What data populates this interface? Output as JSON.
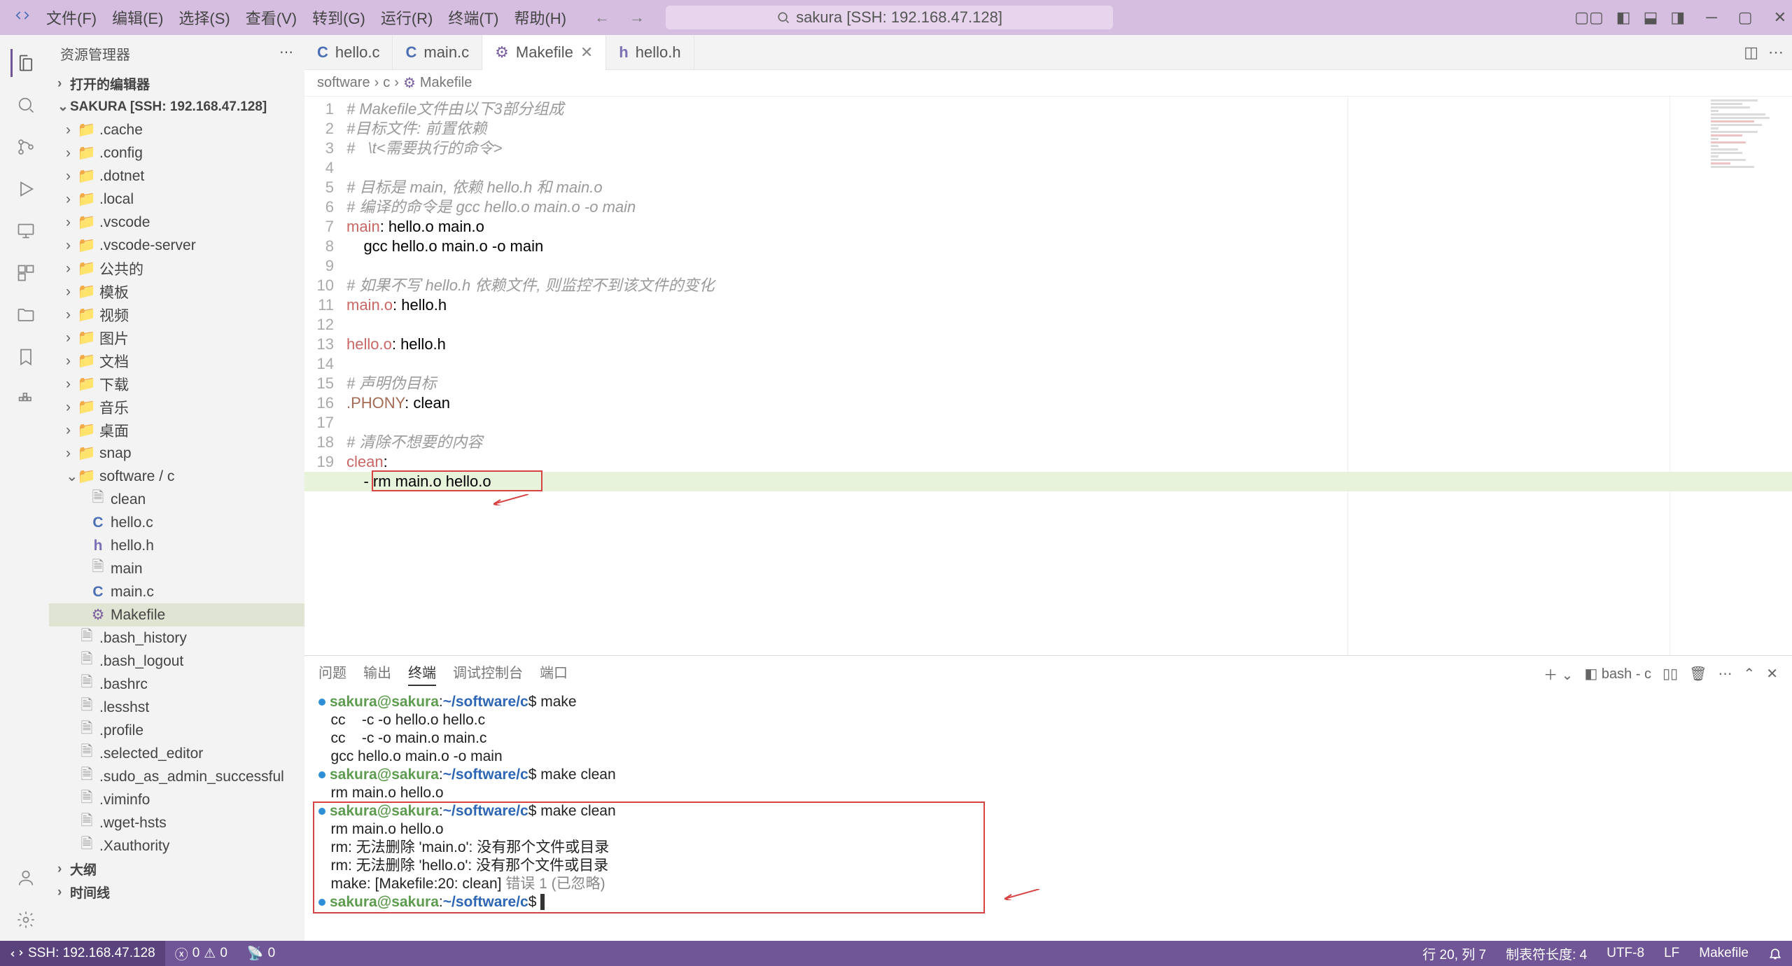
{
  "menubar": [
    "文件(F)",
    "编辑(E)",
    "选择(S)",
    "查看(V)",
    "转到(G)",
    "运行(R)",
    "终端(T)",
    "帮助(H)"
  ],
  "search_placeholder": "sakura [SSH: 192.168.47.128]",
  "sidebar_title": "资源管理器",
  "sections": {
    "open_editors": "打开的编辑器",
    "workspace": "SAKURA [SSH: 192.168.47.128]",
    "outline": "大纲",
    "timeline": "时间线"
  },
  "tree": [
    {
      "d": 1,
      "kind": "folder",
      "label": ".cache"
    },
    {
      "d": 1,
      "kind": "folder",
      "label": ".config"
    },
    {
      "d": 1,
      "kind": "folder",
      "label": ".dotnet"
    },
    {
      "d": 1,
      "kind": "folder",
      "label": ".local"
    },
    {
      "d": 1,
      "kind": "folder",
      "label": ".vscode"
    },
    {
      "d": 1,
      "kind": "folder",
      "label": ".vscode-server"
    },
    {
      "d": 1,
      "kind": "folder",
      "label": "公共的"
    },
    {
      "d": 1,
      "kind": "folder",
      "label": "模板"
    },
    {
      "d": 1,
      "kind": "folder",
      "label": "视频"
    },
    {
      "d": 1,
      "kind": "folder",
      "label": "图片"
    },
    {
      "d": 1,
      "kind": "folder",
      "label": "文档"
    },
    {
      "d": 1,
      "kind": "folder",
      "label": "下载"
    },
    {
      "d": 1,
      "kind": "folder",
      "label": "音乐"
    },
    {
      "d": 1,
      "kind": "folder",
      "label": "桌面"
    },
    {
      "d": 1,
      "kind": "folder",
      "label": "snap"
    },
    {
      "d": 1,
      "kind": "folder-open",
      "label": "software / c"
    },
    {
      "d": 2,
      "kind": "file",
      "label": "clean"
    },
    {
      "d": 2,
      "kind": "c",
      "label": "hello.c"
    },
    {
      "d": 2,
      "kind": "h",
      "label": "hello.h"
    },
    {
      "d": 2,
      "kind": "file",
      "label": "main"
    },
    {
      "d": 2,
      "kind": "c",
      "label": "main.c"
    },
    {
      "d": 2,
      "kind": "make",
      "label": "Makefile",
      "selected": true
    },
    {
      "d": 1,
      "kind": "file",
      "label": ".bash_history"
    },
    {
      "d": 1,
      "kind": "file",
      "label": ".bash_logout"
    },
    {
      "d": 1,
      "kind": "file",
      "label": ".bashrc"
    },
    {
      "d": 1,
      "kind": "file",
      "label": ".lesshst"
    },
    {
      "d": 1,
      "kind": "file",
      "label": ".profile"
    },
    {
      "d": 1,
      "kind": "file",
      "label": ".selected_editor"
    },
    {
      "d": 1,
      "kind": "file",
      "label": ".sudo_as_admin_successful"
    },
    {
      "d": 1,
      "kind": "file",
      "label": ".viminfo"
    },
    {
      "d": 1,
      "kind": "file",
      "label": ".wget-hsts"
    },
    {
      "d": 1,
      "kind": "file",
      "label": ".Xauthority"
    }
  ],
  "tabs": [
    {
      "icon": "c",
      "label": "hello.c",
      "active": false
    },
    {
      "icon": "c",
      "label": "main.c",
      "active": false
    },
    {
      "icon": "make",
      "label": "Makefile",
      "active": true,
      "close": true
    },
    {
      "icon": "h",
      "label": "hello.h",
      "active": false
    }
  ],
  "breadcrumb": [
    "software",
    "c",
    "Makefile"
  ],
  "code_lines": [
    {
      "n": 1,
      "c": "comment",
      "t": "# Makefile文件由以下3部分组成"
    },
    {
      "n": 2,
      "c": "comment",
      "t": "#目标文件: 前置依赖"
    },
    {
      "n": 3,
      "c": "comment",
      "t": "#   \\t<需要执行的命令>"
    },
    {
      "n": 4,
      "c": "",
      "t": ""
    },
    {
      "n": 5,
      "c": "comment",
      "t": "# 目标是 main, 依赖 hello.h 和 main.o"
    },
    {
      "n": 6,
      "c": "comment",
      "t": "# 编译的命令是 gcc hello.o main.o -o main"
    },
    {
      "n": 7,
      "c": "",
      "t": "<span class='target'>main</span>: hello.o main.o"
    },
    {
      "n": 8,
      "c": "",
      "t": "    gcc hello.o main.o -o main"
    },
    {
      "n": 9,
      "c": "",
      "t": ""
    },
    {
      "n": 10,
      "c": "comment",
      "t": "# 如果不写 hello.h 依赖文件, 则监控不到该文件的变化"
    },
    {
      "n": 11,
      "c": "",
      "t": "<span class='target'>main.o</span>: hello.h"
    },
    {
      "n": 12,
      "c": "",
      "t": ""
    },
    {
      "n": 13,
      "c": "",
      "t": "<span class='target'>hello.o</span>: hello.h"
    },
    {
      "n": 14,
      "c": "",
      "t": ""
    },
    {
      "n": 15,
      "c": "comment",
      "t": "# 声明伪目标"
    },
    {
      "n": 16,
      "c": "",
      "t": "<span class='phony-kw'>.PHONY</span>: clean"
    },
    {
      "n": 17,
      "c": "",
      "t": ""
    },
    {
      "n": 18,
      "c": "comment",
      "t": "# 清除不想要的内容"
    },
    {
      "n": 19,
      "c": "",
      "t": "<span class='target'>clean</span>:"
    },
    {
      "n": 20,
      "c": "",
      "t": "    - rm main.o hello.o"
    }
  ],
  "panel_tabs": {
    "problems": "问题",
    "output": "输出",
    "terminal": "终端",
    "debug": "调试控制台",
    "ports": "端口"
  },
  "terminal_label": "bash - c",
  "terminal_lines": [
    {
      "dot": true,
      "html": "<span class='t-user'>sakura@sakura</span><span class='t-norm'>:</span><span class='t-blue'>~/software/c</span><span class='t-norm'>$ make</span>"
    },
    {
      "html": "<span class='t-norm'>cc    -c -o hello.o hello.c</span>"
    },
    {
      "html": "<span class='t-norm'>cc    -c -o main.o main.c</span>"
    },
    {
      "html": "<span class='t-norm'>gcc hello.o main.o -o main</span>"
    },
    {
      "dot": true,
      "html": "<span class='t-user'>sakura@sakura</span><span class='t-norm'>:</span><span class='t-blue'>~/software/c</span><span class='t-norm'>$ make clean</span>"
    },
    {
      "html": "<span class='t-norm'>rm main.o hello.o</span>"
    },
    {
      "dot": true,
      "html": "<span class='t-user'>sakura@sakura</span><span class='t-norm'>:</span><span class='t-blue'>~/software/c</span><span class='t-norm'>$ make clean</span>"
    },
    {
      "html": "<span class='t-norm'>rm main.o hello.o</span>"
    },
    {
      "html": "<span class='t-norm'>rm: 无法删除 'main.o': 没有那个文件或目录</span>"
    },
    {
      "html": "<span class='t-norm'>rm: 无法删除 'hello.o': 没有那个文件或目录</span>"
    },
    {
      "html": "<span class='t-norm'>make: [Makefile:20: clean] </span><span class='t-grey'>错误 1 (已忽略)</span>"
    },
    {
      "dot": true,
      "html": "<span class='t-user'>sakura@sakura</span><span class='t-norm'>:</span><span class='t-blue'>~/software/c</span><span class='t-norm'>$ </span><span style='background:#333;color:#333'>.</span>"
    }
  ],
  "status": {
    "remote": "SSH: 192.168.47.128",
    "errors": "0",
    "warnings": "0",
    "ports": "0",
    "pos": "行 20, 列 7",
    "tabsize": "制表符长度: 4",
    "encoding": "UTF-8",
    "eol": "LF",
    "lang": "Makefile"
  }
}
